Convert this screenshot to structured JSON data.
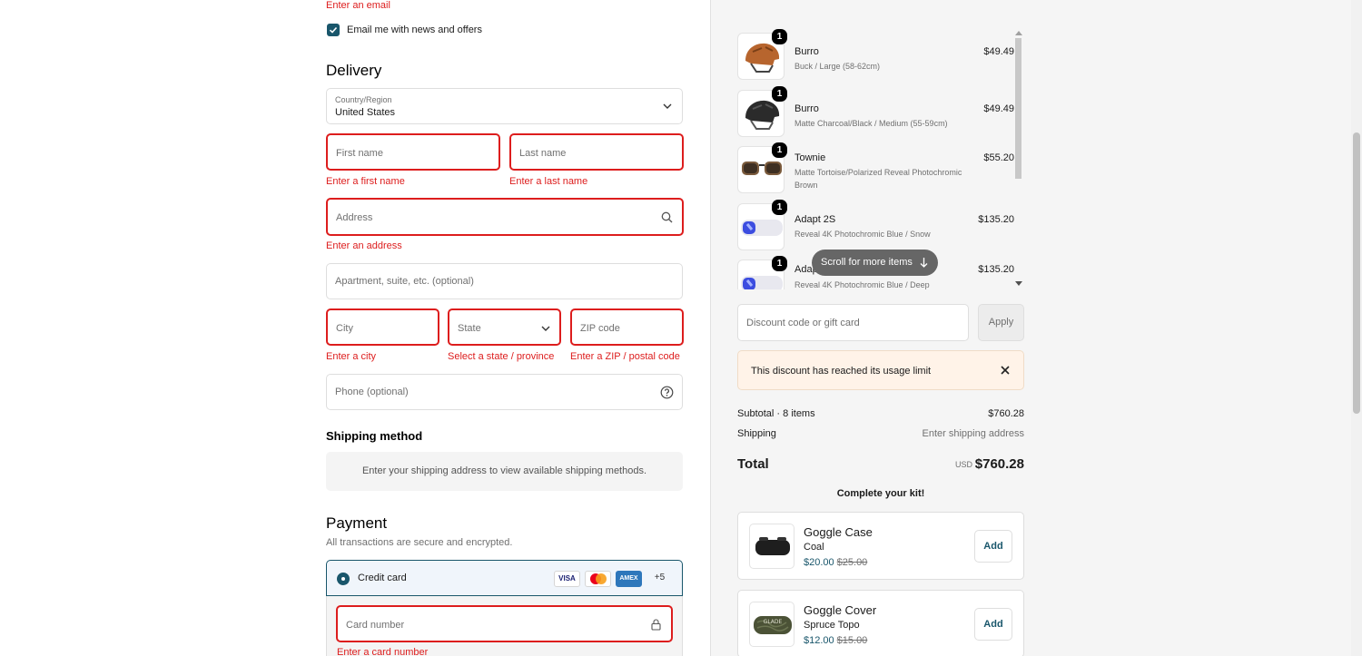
{
  "contact": {
    "email_error": "Enter an email",
    "newsletter_label": "Email me with news and offers"
  },
  "delivery": {
    "heading": "Delivery",
    "country_label": "Country/Region",
    "country_value": "United States",
    "first_name_placeholder": "First name",
    "first_name_error": "Enter a first name",
    "last_name_placeholder": "Last name",
    "last_name_error": "Enter a last name",
    "address_placeholder": "Address",
    "address_error": "Enter an address",
    "apartment_placeholder": "Apartment, suite, etc. (optional)",
    "city_placeholder": "City",
    "city_error": "Enter a city",
    "state_placeholder": "State",
    "state_error": "Select a state / province",
    "zip_placeholder": "ZIP code",
    "zip_error": "Enter a ZIP / postal code",
    "phone_placeholder": "Phone (optional)"
  },
  "shipping": {
    "heading": "Shipping method",
    "info": "Enter your shipping address to view available shipping methods."
  },
  "payment": {
    "heading": "Payment",
    "subheading": "All transactions are secure and encrypted.",
    "method_label": "Credit card",
    "card_logos": [
      "VISA",
      "MC",
      "AMEX"
    ],
    "more_cards": "+5",
    "card_number_placeholder": "Card number",
    "card_number_error": "Enter a card number"
  },
  "cart": {
    "items": [
      {
        "qty": "1",
        "name": "Burro",
        "variant": "Buck / Large (58-62cm)",
        "price": "$49.49",
        "icon": "helmet-brown-icon"
      },
      {
        "qty": "1",
        "name": "Burro",
        "variant": "Matte Charcoal/Black / Medium (55-59cm)",
        "price": "$49.49",
        "icon": "helmet-black-icon"
      },
      {
        "qty": "1",
        "name": "Townie",
        "variant": "Matte Tortoise/Polarized Reveal Photochromic Brown",
        "price": "$55.20",
        "icon": "sunglasses-icon"
      },
      {
        "qty": "1",
        "name": "Adapt 2S",
        "variant": "Reveal 4K Photochromic Blue / Snow",
        "price": "$135.20",
        "icon": "goggles-icon"
      },
      {
        "qty": "1",
        "name": "Adapt 2S",
        "variant": "Reveal 4K Photochromic Blue / Deep",
        "price": "$135.20",
        "icon": "goggles-icon"
      }
    ],
    "scroll_hint": "Scroll for more items",
    "discount_placeholder": "Discount code or gift card",
    "apply_label": "Apply",
    "alert_text": "This discount has reached its usage limit",
    "subtotal_label": "Subtotal · 8 items",
    "subtotal_value": "$760.28",
    "shipping_label": "Shipping",
    "shipping_value": "Enter shipping address",
    "total_label": "Total",
    "currency": "USD",
    "total_value": "$760.28"
  },
  "upsell": {
    "heading": "Complete your kit!",
    "items": [
      {
        "name": "Goggle Case",
        "variant": "Coal",
        "price": "$20.00",
        "old_price": "$25.00",
        "add_label": "Add"
      },
      {
        "name": "Goggle Cover",
        "variant": "Spruce Topo",
        "price": "$12.00",
        "old_price": "$15.00",
        "add_label": "Add",
        "logo_text": "GLADE"
      }
    ]
  },
  "colors": {
    "accent": "#19566b",
    "error": "#dd1d1d",
    "alert_bg": "#fff3e8"
  }
}
